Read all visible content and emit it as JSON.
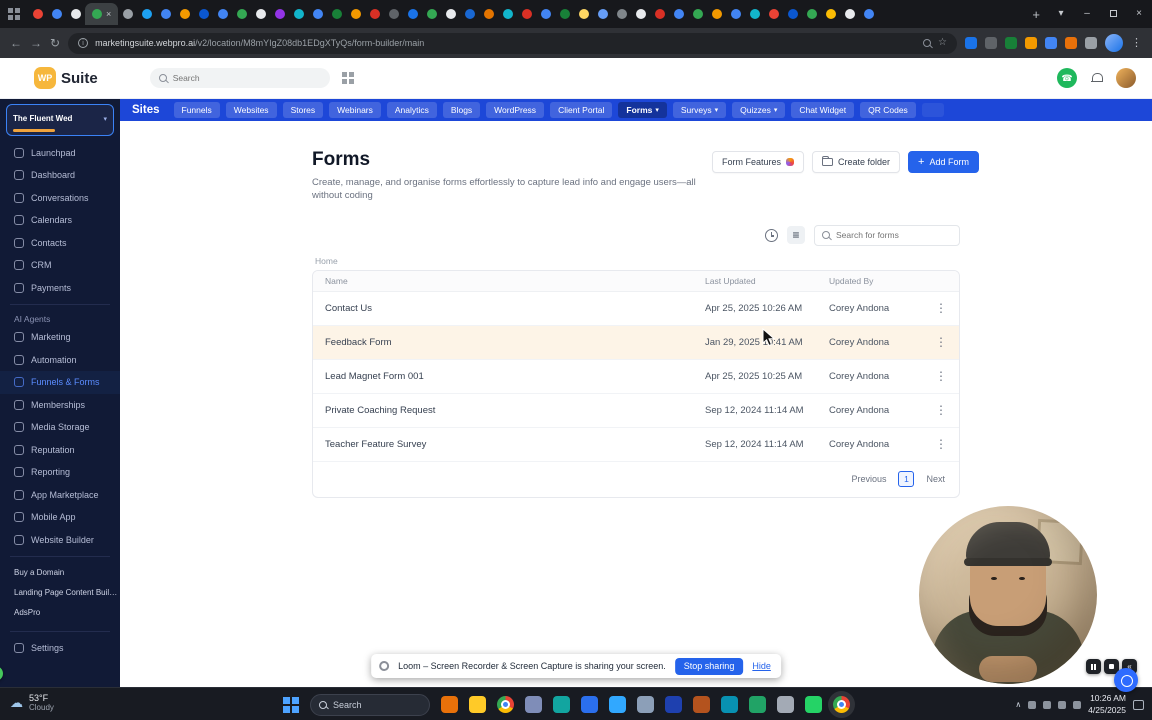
{
  "theme": {
    "accent": "#2563eb",
    "nav_blue": "#1d47d8",
    "sidebar_bg": "#111a36",
    "row_highlight": "#fdf4e7",
    "taskbar_bg": "#181b22",
    "tabstrip_bg": "#17181c",
    "toolbar_bg": "#2f3136"
  },
  "browser": {
    "url_host": "marketingsuite.webpro.ai",
    "url_path": "/v2/location/M8mYIgZ08db1EDgXTyQs/form-builder/main",
    "tabs": [
      {
        "color": "#ea4335"
      },
      {
        "color": "#4285f4"
      },
      {
        "color": "#e8eaed"
      },
      {
        "color": "#34a853",
        "active": true
      },
      {
        "color": "#9aa0a6"
      },
      {
        "color": "#1da1f2"
      },
      {
        "color": "#4285f4"
      },
      {
        "color": "#f29900"
      },
      {
        "color": "#0b57d0"
      },
      {
        "color": "#4285f4"
      },
      {
        "color": "#34a853"
      },
      {
        "color": "#e8eaed"
      },
      {
        "color": "#9334e6"
      },
      {
        "color": "#12b5cb"
      },
      {
        "color": "#4285f4"
      },
      {
        "color": "#188038"
      },
      {
        "color": "#f29900"
      },
      {
        "color": "#d93025"
      },
      {
        "color": "#5f6368"
      },
      {
        "color": "#1a73e8"
      },
      {
        "color": "#34a853"
      },
      {
        "color": "#e8eaed"
      },
      {
        "color": "#1967d2"
      },
      {
        "color": "#e37400"
      },
      {
        "color": "#12b5cb"
      },
      {
        "color": "#d93025"
      },
      {
        "color": "#4285f4"
      },
      {
        "color": "#188038"
      },
      {
        "color": "#fdd663"
      },
      {
        "color": "#669df6"
      },
      {
        "color": "#80868b"
      },
      {
        "color": "#e8eaed"
      },
      {
        "color": "#d93025"
      },
      {
        "color": "#4285f4"
      },
      {
        "color": "#34a853"
      },
      {
        "color": "#f29900"
      },
      {
        "color": "#4285f4"
      },
      {
        "color": "#12b5cb"
      },
      {
        "color": "#ea4335"
      },
      {
        "color": "#0b57d0"
      },
      {
        "color": "#34a853"
      },
      {
        "color": "#fbbc04"
      },
      {
        "color": "#e8eaed"
      },
      {
        "color": "#4285f4"
      }
    ],
    "extensions": [
      {
        "color": "#1a73e8"
      },
      {
        "color": "#5f6368"
      },
      {
        "color": "#188038"
      },
      {
        "color": "#f29900"
      },
      {
        "color": "#4285f4"
      },
      {
        "color": "#e8710a"
      },
      {
        "color": "#9aa0a6"
      }
    ]
  },
  "header": {
    "logo_badge": "WP",
    "logo_text": "Suite",
    "search_placeholder": "Search"
  },
  "sidebar": {
    "account_name": "The Fluent Wed",
    "items_primary": [
      {
        "label": "Launchpad"
      },
      {
        "label": "Dashboard"
      },
      {
        "label": "Conversations"
      },
      {
        "label": "Calendars"
      },
      {
        "label": "Contacts"
      },
      {
        "label": "CRM"
      },
      {
        "label": "Payments"
      }
    ],
    "section_label": "AI Agents",
    "items_tools": [
      {
        "label": "Marketing"
      },
      {
        "label": "Automation"
      },
      {
        "label": "Funnels & Forms",
        "active": true
      },
      {
        "label": "Memberships"
      },
      {
        "label": "Media Storage"
      },
      {
        "label": "Reputation"
      },
      {
        "label": "Reporting"
      },
      {
        "label": "App Marketplace"
      },
      {
        "label": "Mobile App"
      },
      {
        "label": "Website Builder"
      }
    ],
    "items_secondary": [
      {
        "label": "Buy a Domain"
      },
      {
        "label": "Landing Page Content Builder"
      },
      {
        "label": "AdsPro"
      }
    ],
    "settings_label": "Settings"
  },
  "topnav": {
    "brand": "Sites",
    "items": [
      {
        "label": "Funnels"
      },
      {
        "label": "Websites"
      },
      {
        "label": "Stores"
      },
      {
        "label": "Webinars"
      },
      {
        "label": "Analytics"
      },
      {
        "label": "Blogs"
      },
      {
        "label": "WordPress"
      },
      {
        "label": "Client Portal"
      },
      {
        "label": "Forms",
        "caret": true,
        "active": true
      },
      {
        "label": "Surveys",
        "caret": true
      },
      {
        "label": "Quizzes",
        "caret": true
      },
      {
        "label": "Chat Widget"
      },
      {
        "label": "QR Codes"
      },
      {
        "label": "",
        "dim": true
      }
    ]
  },
  "main": {
    "title": "Forms",
    "description": "Create, manage, and organise forms effortlessly to capture lead info and engage users—all without coding",
    "form_features_label": "Form Features",
    "create_folder_label": "Create folder",
    "add_form_label": "Add Form",
    "search_placeholder": "Search for forms",
    "breadcrumb": "Home",
    "table": {
      "columns": {
        "name": "Name",
        "updated": "Last Updated",
        "by": "Updated By"
      },
      "rows": [
        {
          "name": "Contact Us",
          "updated": "Apr 25, 2025 10:26 AM",
          "by": "Corey Andona"
        },
        {
          "name": "Feedback Form",
          "updated": "Jan 29, 2025 10:41 AM",
          "by": "Corey Andona",
          "highlight": true
        },
        {
          "name": "Lead Magnet Form 001",
          "updated": "Apr 25, 2025 10:25 AM",
          "by": "Corey Andona"
        },
        {
          "name": "Private Coaching Request",
          "updated": "Sep 12, 2024 11:14 AM",
          "by": "Corey Andona"
        },
        {
          "name": "Teacher Feature Survey",
          "updated": "Sep 12, 2024 11:14 AM",
          "by": "Corey Andona"
        }
      ]
    },
    "pagination": {
      "previous": "Previous",
      "page": "1",
      "next": "Next"
    }
  },
  "loom": {
    "message": "Loom – Screen Recorder & Screen Capture is sharing your screen.",
    "stop_label": "Stop sharing",
    "hide_label": "Hide"
  },
  "taskbar": {
    "weather_temp": "53°F",
    "weather_condition": "Cloudy",
    "search_placeholder": "Search",
    "icons": [
      {
        "color": "#e8710a"
      },
      {
        "color": "#ffca28"
      },
      {
        "chrome": true
      },
      {
        "color": "#7f8db8"
      },
      {
        "color": "#12a5a0"
      },
      {
        "color": "#2b6fed"
      },
      {
        "color": "#31a8ff"
      },
      {
        "color": "#8c9fb8"
      },
      {
        "color": "#1e40af"
      },
      {
        "color": "#b4531e"
      },
      {
        "color": "#0891b2"
      },
      {
        "color": "#21a366"
      },
      {
        "color": "#a3aab5"
      },
      {
        "color": "#25d366"
      },
      {
        "chrome": true,
        "active": true
      }
    ],
    "time": "10:26 AM",
    "date": "4/25/2025"
  }
}
